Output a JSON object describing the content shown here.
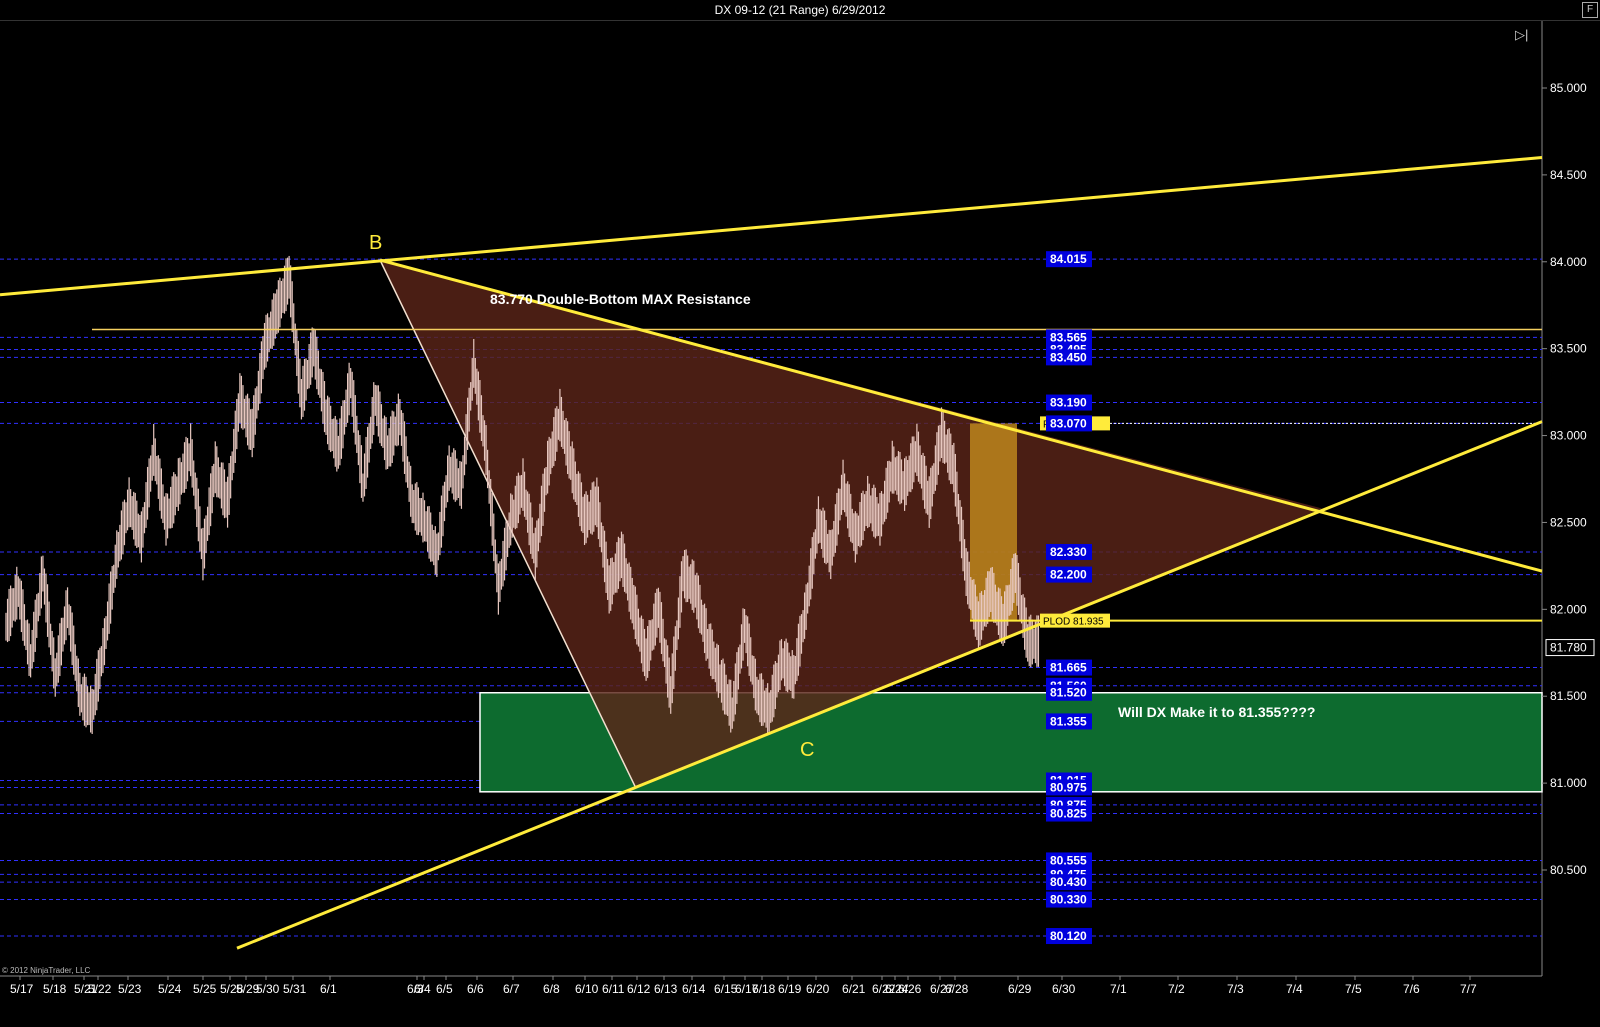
{
  "window": {
    "title": "DX 09-12 (21 Range)  6/29/2012",
    "corner_button": "F"
  },
  "copyright": "© 2012 NinjaTrader, LLC",
  "colors": {
    "background": "#000000",
    "trend_line": "#ffeb3b",
    "triangle_fill": "#5a2419",
    "zone_fill": "#0d6b2f",
    "level_line": "#3030ff",
    "label_bg": "#0000dd",
    "candles": "#e8c8c0"
  },
  "chart_data": {
    "type": "candlestick",
    "title": "DX 09-12 (21 Range)  6/29/2012",
    "ylim": [
      80.0,
      85.3
    ],
    "y_ticks": [
      "85.000",
      "84.500",
      "84.000",
      "83.500",
      "83.000",
      "82.500",
      "82.000",
      "81.500",
      "81.000",
      "80.500"
    ],
    "x_ticks": [
      "5/17",
      "5/18",
      "5/21",
      "5/22",
      "5/23",
      "5/24",
      "5/25",
      "5/28",
      "5/29",
      "5/30",
      "5/31",
      "6/1",
      "6/3",
      "6/4",
      "6/5",
      "6/6",
      "6/7",
      "6/8",
      "6/10",
      "6/11",
      "6/12",
      "6/13",
      "6/14",
      "6/15",
      "6/17",
      "6/18",
      "6/19",
      "6/20",
      "6/21",
      "6/22",
      "6/24",
      "6/26",
      "6/27",
      "6/28",
      "6/29",
      "6/30",
      "7/1",
      "7/2",
      "7/3",
      "7/4",
      "7/5",
      "7/6",
      "7/7"
    ],
    "last_price": "81.780",
    "price_path": [
      81.9,
      82.1,
      81.7,
      82.2,
      81.6,
      82.0,
      81.5,
      81.4,
      81.8,
      82.3,
      82.6,
      82.4,
      82.9,
      82.5,
      82.7,
      82.9,
      82.3,
      82.8,
      82.6,
      83.2,
      83.0,
      83.5,
      83.7,
      83.9,
      83.2,
      83.5,
      83.1,
      82.9,
      83.3,
      82.7,
      83.2,
      82.9,
      83.1,
      82.6,
      82.5,
      82.3,
      82.8,
      82.7,
      83.4,
      82.9,
      82.1,
      82.5,
      82.7,
      82.3,
      82.8,
      83.1,
      82.8,
      82.5,
      82.6,
      82.1,
      82.3,
      82.0,
      81.7,
      82.0,
      81.5,
      82.2,
      82.1,
      81.8,
      81.6,
      81.4,
      81.9,
      81.5,
      81.4,
      81.7,
      81.6,
      82.0,
      82.5,
      82.3,
      82.7,
      82.4,
      82.6,
      82.5,
      82.8,
      82.7,
      82.9,
      82.6,
      83.0,
      82.8,
      82.2,
      81.9,
      82.1,
      81.9,
      82.2,
      81.8
    ],
    "levels": [
      {
        "value": 84.015,
        "label": "84.015"
      },
      {
        "value": 83.565,
        "label": "83.565"
      },
      {
        "value": 83.495,
        "label": "83.495"
      },
      {
        "value": 83.45,
        "label": "83.450"
      },
      {
        "value": 83.19,
        "label": "83.190"
      },
      {
        "value": 83.07,
        "label": "83.070"
      },
      {
        "value": 82.33,
        "label": "82.330"
      },
      {
        "value": 82.2,
        "label": "82.200"
      },
      {
        "value": 81.665,
        "label": "81.665"
      },
      {
        "value": 81.56,
        "label": "81.560"
      },
      {
        "value": 81.52,
        "label": "81.520"
      },
      {
        "value": 81.355,
        "label": "81.355"
      },
      {
        "value": 81.015,
        "label": "81.015"
      },
      {
        "value": 80.975,
        "label": "80.975"
      },
      {
        "value": 80.875,
        "label": "80.875"
      },
      {
        "value": 80.825,
        "label": "80.825"
      },
      {
        "value": 80.555,
        "label": "80.555"
      },
      {
        "value": 80.475,
        "label": "80.475"
      },
      {
        "value": 80.43,
        "label": "80.430"
      },
      {
        "value": 80.33,
        "label": "80.330"
      },
      {
        "value": 80.12,
        "label": "80.120"
      }
    ],
    "annotations": {
      "point_b": "B",
      "point_c": "C",
      "resistance_text": "83.770 Double-Bottom MAX Resistance",
      "question_text": "Will DX Make it to 81.355????",
      "plod_label": "PLOD 81.935",
      "pr_label": "PR 83.070"
    },
    "plod_value": 81.935,
    "pr_value": 83.07,
    "resistance_value": 83.61,
    "zone": {
      "from": 80.95,
      "to": 81.52
    }
  }
}
